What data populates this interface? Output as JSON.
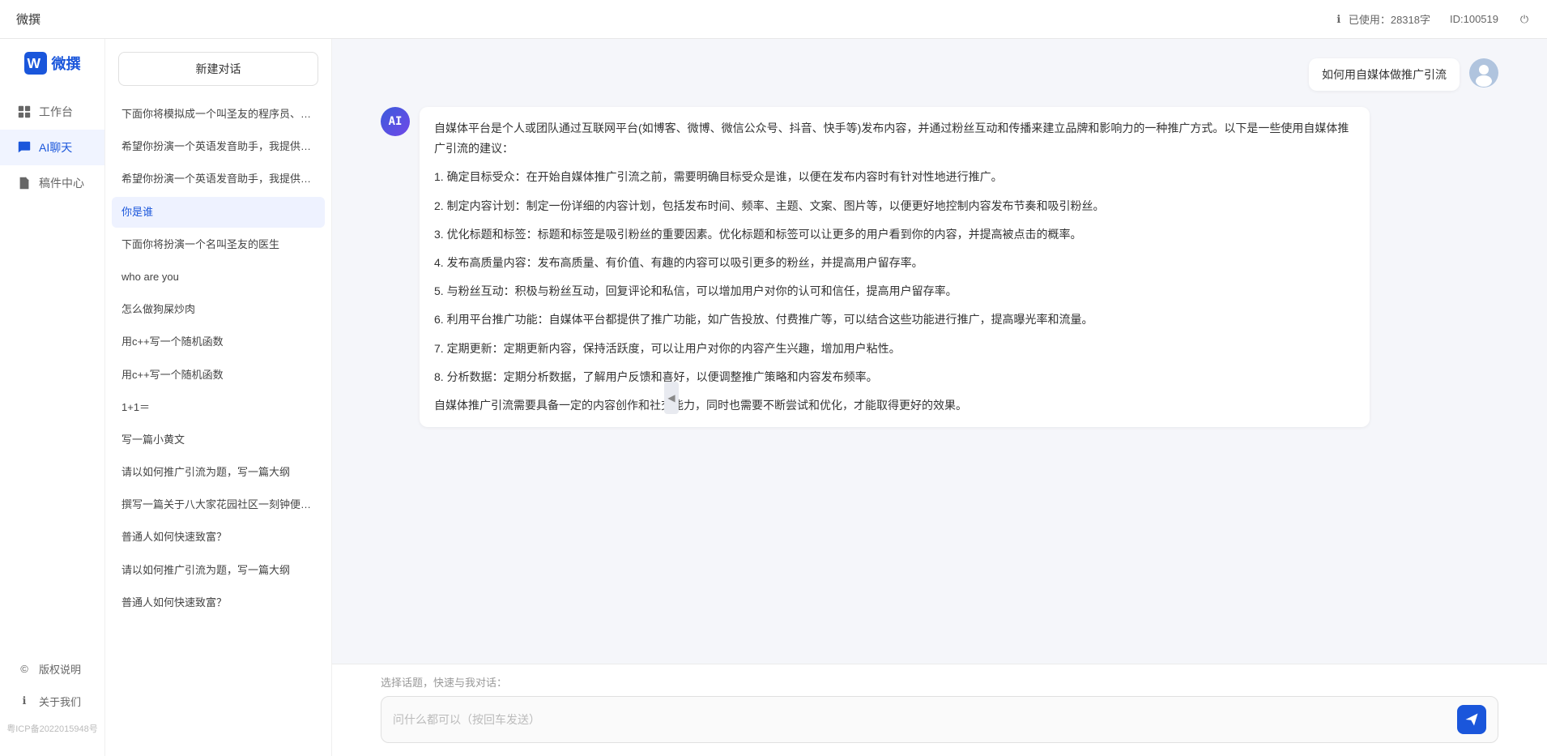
{
  "topbar": {
    "title": "微撰",
    "usage_label": "已使用：28318字",
    "id_label": "ID:100519",
    "usage_icon": "info-icon",
    "power_icon": "power-icon"
  },
  "sidebar": {
    "logo_text": "微撰",
    "items": [
      {
        "id": "workbench",
        "label": "工作台",
        "icon": "grid-icon"
      },
      {
        "id": "ai-chat",
        "label": "AI聊天",
        "icon": "chat-icon",
        "active": true
      },
      {
        "id": "drafts",
        "label": "稿件中心",
        "icon": "doc-icon"
      }
    ],
    "bottom_items": [
      {
        "id": "copyright",
        "label": "版权说明",
        "icon": "copyright-icon"
      },
      {
        "id": "about",
        "label": "关于我们",
        "icon": "info-circle-icon"
      }
    ],
    "icp": "粤ICP备2022015948号"
  },
  "history": {
    "new_btn_label": "新建对话",
    "items": [
      {
        "id": 1,
        "text": "下面你将模拟成一个叫圣友的程序员、我说..."
      },
      {
        "id": 2,
        "text": "希望你扮演一个英语发音助手，我提供给你..."
      },
      {
        "id": 3,
        "text": "希望你扮演一个英语发音助手，我提供给你..."
      },
      {
        "id": 4,
        "text": "你是谁",
        "active": true
      },
      {
        "id": 5,
        "text": "下面你将扮演一个名叫圣友的医生"
      },
      {
        "id": 6,
        "text": "who are you"
      },
      {
        "id": 7,
        "text": "怎么做狗屎炒肉"
      },
      {
        "id": 8,
        "text": "用c++写一个随机函数"
      },
      {
        "id": 9,
        "text": "用c++写一个随机函数"
      },
      {
        "id": 10,
        "text": "1+1＝"
      },
      {
        "id": 11,
        "text": "写一篇小黄文"
      },
      {
        "id": 12,
        "text": "请以如何推广引流为题，写一篇大纲"
      },
      {
        "id": 13,
        "text": "撰写一篇关于八大家花园社区一刻钟便民生..."
      },
      {
        "id": 14,
        "text": "普通人如何快速致富？"
      },
      {
        "id": 15,
        "text": "请以如何推广引流为题，写一篇大纲"
      },
      {
        "id": 16,
        "text": "普通人如何快速致富？"
      }
    ]
  },
  "chat": {
    "messages": [
      {
        "id": 1,
        "type": "user",
        "text": "如何用自媒体做推广引流"
      },
      {
        "id": 2,
        "type": "ai",
        "paragraphs": [
          "自媒体平台是个人或团队通过互联网平台(如博客、微博、微信公众号、抖音、快手等)发布内容，并通过粉丝互动和传播来建立品牌和影响力的一种推广方式。以下是一些使用自媒体推广引流的建议：",
          "1. 确定目标受众：在开始自媒体推广引流之前，需要明确目标受众是谁，以便在发布内容时有针对性地进行推广。",
          "2. 制定内容计划：制定一份详细的内容计划，包括发布时间、频率、主题、文案、图片等，以便更好地控制内容发布节奏和吸引粉丝。",
          "3. 优化标题和标签：标题和标签是吸引粉丝的重要因素。优化标题和标签可以让更多的用户看到你的内容，并提高被点击的概率。",
          "4. 发布高质量内容：发布高质量、有价值、有趣的内容可以吸引更多的粉丝，并提高用户留存率。",
          "5. 与粉丝互动：积极与粉丝互动，回复评论和私信，可以增加用户对你的认可和信任，提高用户留存率。",
          "6. 利用平台推广功能：自媒体平台都提供了推广功能，如广告投放、付费推广等，可以结合这些功能进行推广，提高曝光率和流量。",
          "7. 定期更新：定期更新内容，保持活跃度，可以让用户对你的内容产生兴趣，增加用户粘性。",
          "8. 分析数据：定期分析数据，了解用户反馈和喜好，以便调整推广策略和内容发布频率。",
          "自媒体推广引流需要具备一定的内容创作和社交能力，同时也需要不断尝试和优化，才能取得更好的效果。"
        ]
      }
    ],
    "quick_topics_label": "选择话题，快速与我对话：",
    "input_placeholder": "问什么都可以（按回车发送）"
  }
}
